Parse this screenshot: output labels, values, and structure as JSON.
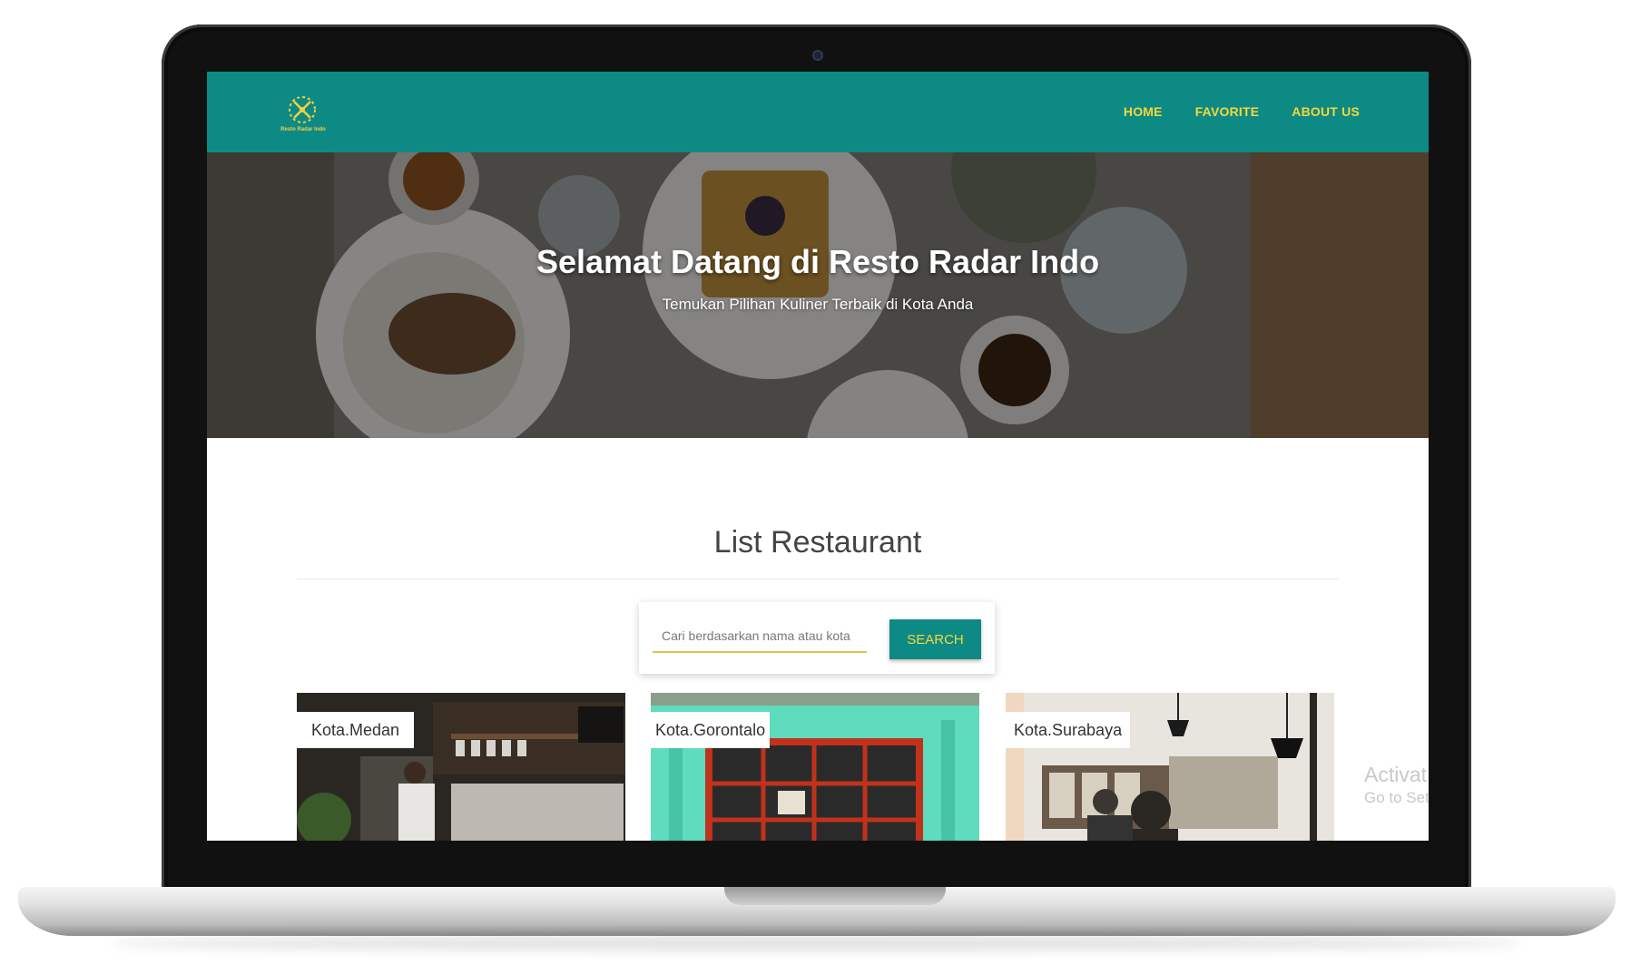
{
  "app": {
    "logo_text": "Resto Radar Indo"
  },
  "nav": {
    "items": [
      {
        "label": "HOME"
      },
      {
        "label": "FAVORITE"
      },
      {
        "label": "ABOUT US"
      }
    ]
  },
  "hero": {
    "title": "Selamat Datang di Resto Radar Indo",
    "subtitle": "Temukan Pilihan Kuliner Terbaik di Kota Anda"
  },
  "main": {
    "section_title": "List Restaurant",
    "search": {
      "placeholder": "Cari berdasarkan nama atau kota",
      "value": "",
      "button_label": "SEARCH"
    },
    "cards": [
      {
        "city": "Kota.Medan"
      },
      {
        "city": "Kota.Gorontalo"
      },
      {
        "city": "Kota.Surabaya"
      }
    ]
  },
  "overlay": {
    "line1": "Activat",
    "line2": "Go to Set"
  },
  "colors": {
    "primary": "#0e8a85",
    "accent": "#f6d73a"
  }
}
